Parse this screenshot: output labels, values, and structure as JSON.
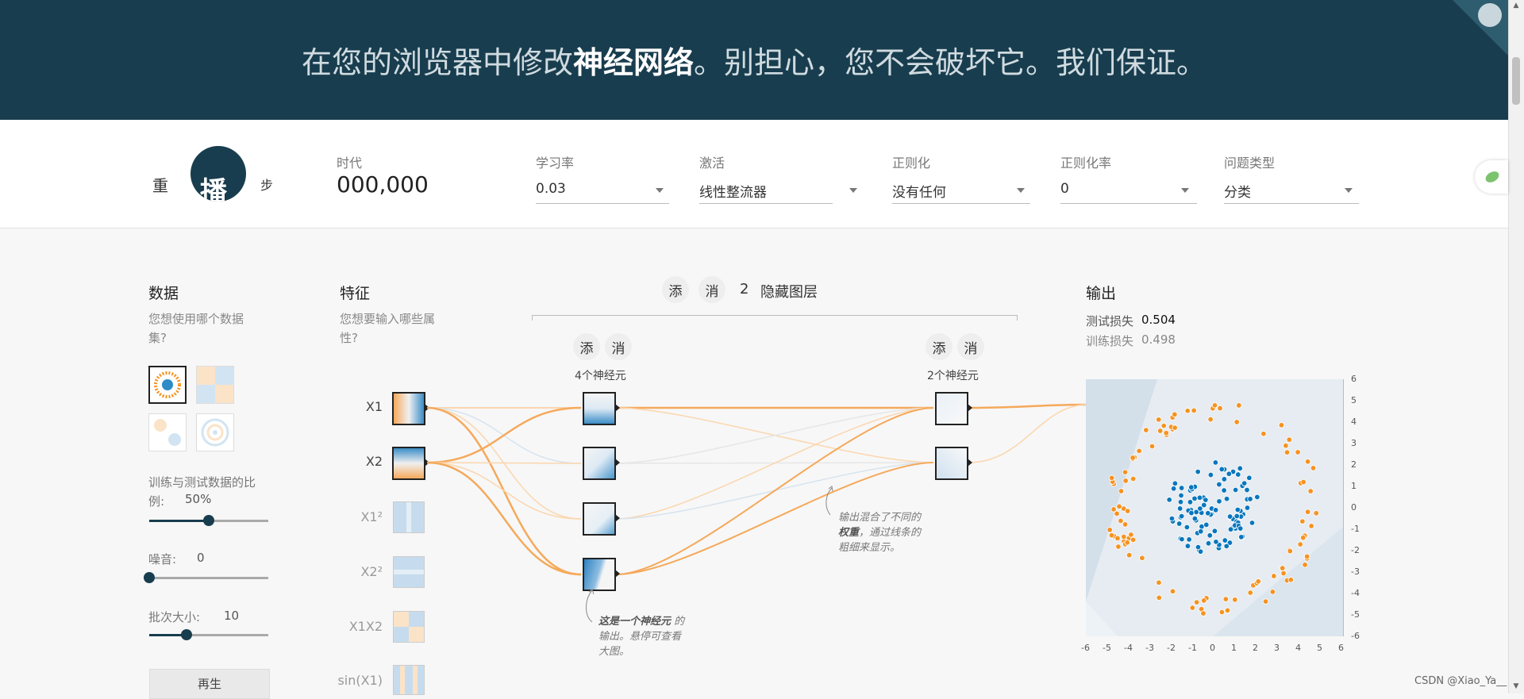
{
  "header": {
    "title_prefix": "在您的浏览器中修改",
    "title_bold": "神经网络",
    "title_suffix": "。别担心，您不会破坏它。我们保证。"
  },
  "controls": {
    "reset_label": "重",
    "play_label": "播",
    "step_label": "步",
    "epoch_label": "时代",
    "epoch_value": "000,000",
    "learning_rate_label": "学习率",
    "learning_rate_value": "0.03",
    "activation_label": "激活",
    "activation_value": "线性整流器",
    "regularization_label": "正则化",
    "regularization_value": "没有任何",
    "reg_rate_label": "正则化率",
    "reg_rate_value": "0",
    "problem_type_label": "问题类型",
    "problem_type_value": "分类"
  },
  "data_panel": {
    "title": "数据",
    "subtitle": "您想使用哪个数据集?",
    "ratio_label": "训练与测试数据的比例:",
    "ratio_value": "50%",
    "ratio_fraction": 0.5,
    "noise_label": "噪音:",
    "noise_value": "0",
    "noise_fraction": 0.0,
    "batch_label": "批次大小:",
    "batch_value": "10",
    "batch_fraction": 0.31,
    "regen_label": "再生"
  },
  "features": {
    "title": "特征",
    "subtitle": "您想要输入哪些属性?",
    "items": [
      {
        "label": "X1",
        "active": true
      },
      {
        "label": "X2",
        "active": true
      },
      {
        "label": "X1²",
        "active": false
      },
      {
        "label": "X2²",
        "active": false
      },
      {
        "label": "X1X2",
        "active": false
      },
      {
        "label": "sin(X1)",
        "active": false
      }
    ]
  },
  "network": {
    "add_label": "添",
    "remove_label": "消",
    "hidden_layers_count": "2",
    "hidden_layers_label": "隐藏图层",
    "layer1_count_label": "4个神经元",
    "layer2_count_label": "2个神经元",
    "note_weights_line1": "输出混合了不同的",
    "note_weights_bold": "权重",
    "note_weights_line2": "，通过线条的",
    "note_weights_line3": "粗细来显示。",
    "note_neuron_bold": "这是一个神经元",
    "note_neuron_line1": " 的",
    "note_neuron_line2": "输出。悬停可查看",
    "note_neuron_line3": "大图。"
  },
  "output": {
    "title": "输出",
    "test_loss_label": "测试损失",
    "test_loss_value": "0.504",
    "train_loss_label": "训练损失",
    "train_loss_value": "0.498",
    "x_ticks": [
      "-6",
      "-5",
      "-4",
      "-3",
      "-2",
      "-1",
      "0",
      "1",
      "2",
      "3",
      "4",
      "5",
      "6"
    ],
    "y_ticks": [
      "6",
      "5",
      "4",
      "3",
      "2",
      "1",
      "0",
      "-1",
      "-2",
      "-3",
      "-4",
      "-5",
      "-6"
    ]
  },
  "colors": {
    "header_bg": "#183d4e",
    "orange": "#f59322",
    "blue": "#0877bd"
  },
  "watermark": "CSDN @Xiao_Ya__"
}
